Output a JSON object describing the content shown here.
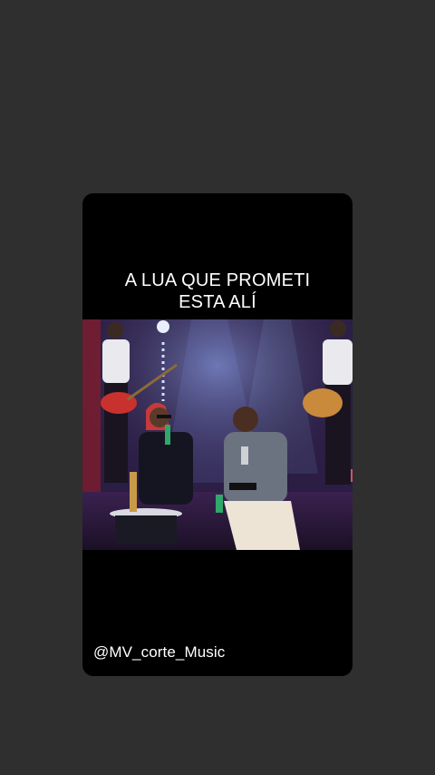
{
  "story": {
    "caption_line1": "A LUA QUE PROMETI",
    "caption_line2": "ESTA ALÍ",
    "watermark": "@MV_corte_Music"
  },
  "video": {
    "description_icon": "music-performance-video"
  },
  "colors": {
    "background": "#2f2f2f",
    "card": "#000000",
    "text": "#ffffff"
  }
}
